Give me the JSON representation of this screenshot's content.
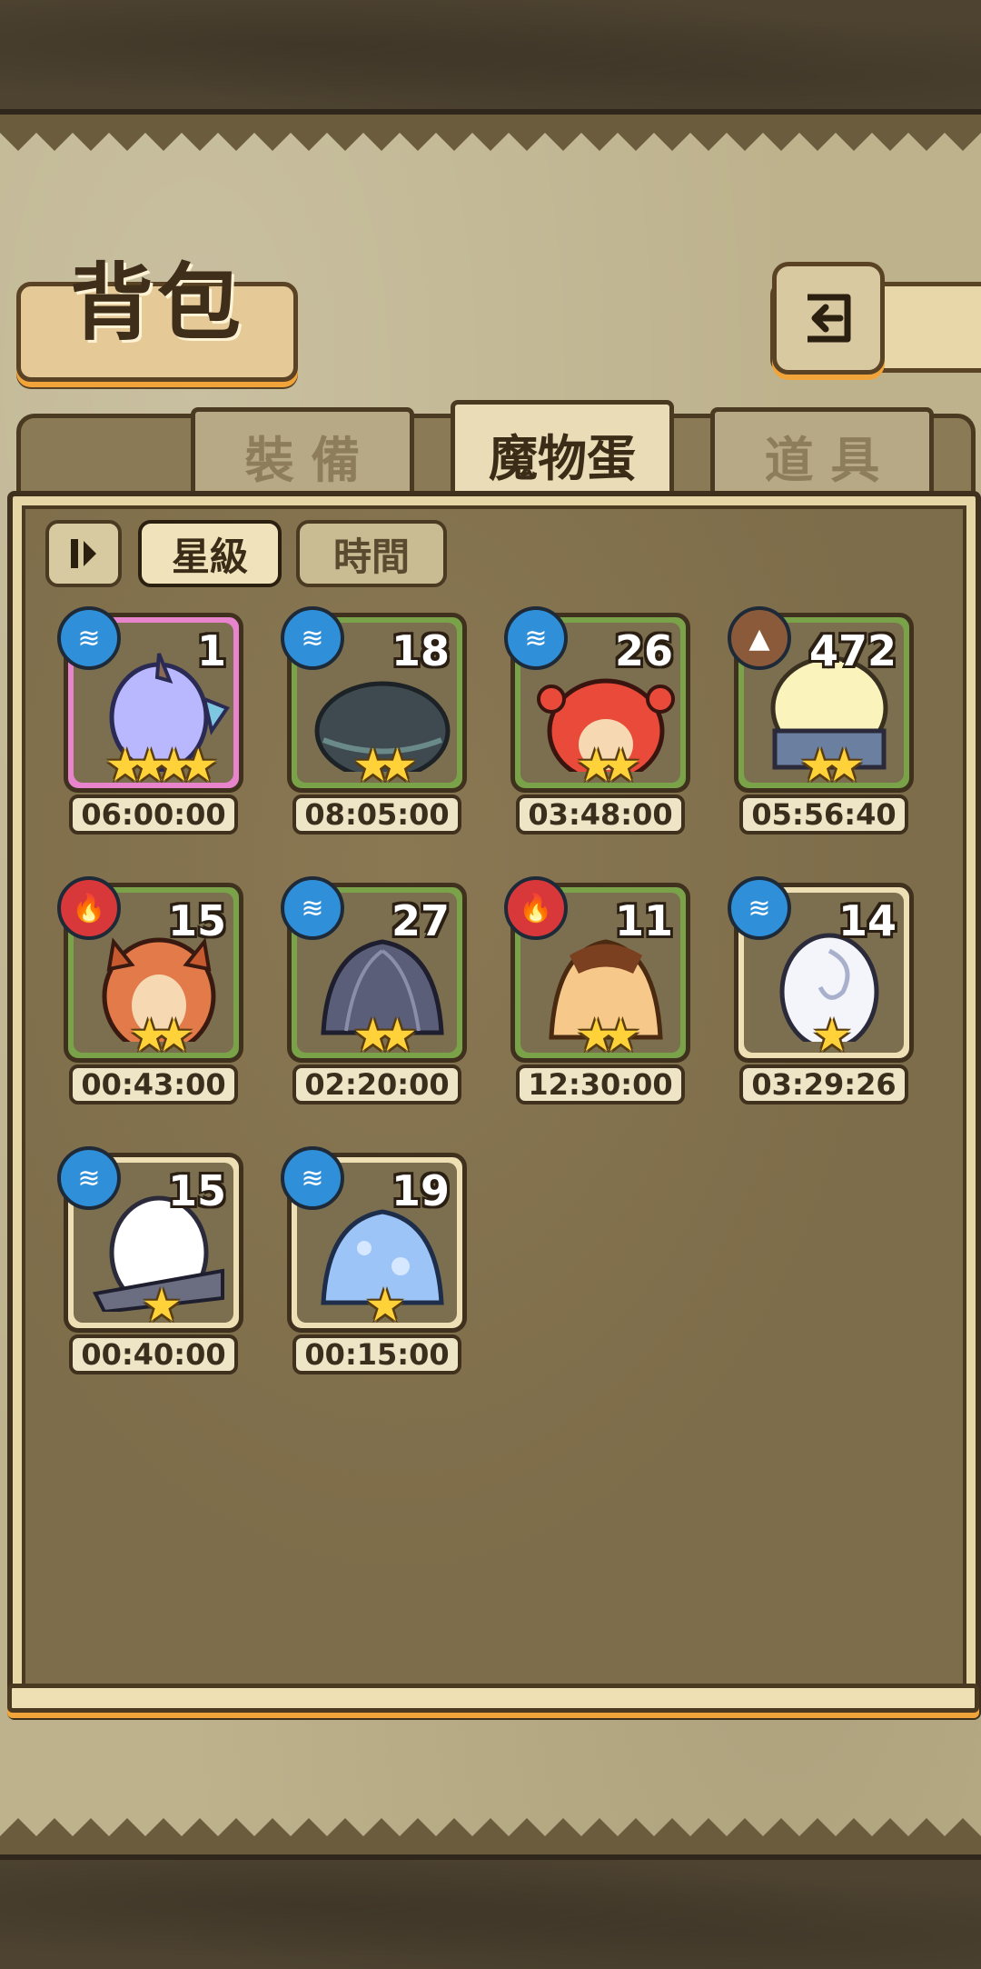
{
  "header": {
    "title": "背包",
    "back_icon": "return-arrow-icon"
  },
  "tabs": [
    {
      "label": "裝 備",
      "active": false
    },
    {
      "label": "魔物蛋",
      "active": true
    },
    {
      "label": "道 具",
      "active": false
    }
  ],
  "sort": {
    "order_icon": "sort-order-icon",
    "options": [
      {
        "label": "星級",
        "selected": true
      },
      {
        "label": "時間",
        "selected": false
      }
    ]
  },
  "eggs": [
    {
      "count": "1",
      "stars": "★★★★",
      "time": "06:00:00",
      "element": "water",
      "frame": "pink"
    },
    {
      "count": "18",
      "stars": "★★",
      "time": "08:05:00",
      "element": "water",
      "frame": "green"
    },
    {
      "count": "26",
      "stars": "★★",
      "time": "03:48:00",
      "element": "water",
      "frame": "green"
    },
    {
      "count": "472",
      "stars": "★★",
      "time": "05:56:40",
      "element": "earth",
      "frame": "green"
    },
    {
      "count": "15",
      "stars": "★★",
      "time": "00:43:00",
      "element": "fire",
      "frame": "green"
    },
    {
      "count": "27",
      "stars": "★★",
      "time": "02:20:00",
      "element": "water",
      "frame": "green"
    },
    {
      "count": "11",
      "stars": "★★",
      "time": "12:30:00",
      "element": "fire",
      "frame": "green"
    },
    {
      "count": "14",
      "stars": "★",
      "time": "03:29:26",
      "element": "water",
      "frame": "cream"
    },
    {
      "count": "15",
      "stars": "★",
      "time": "00:40:00",
      "element": "water",
      "frame": "cream"
    },
    {
      "count": "19",
      "stars": "★",
      "time": "00:15:00",
      "element": "water",
      "frame": "cream"
    }
  ]
}
